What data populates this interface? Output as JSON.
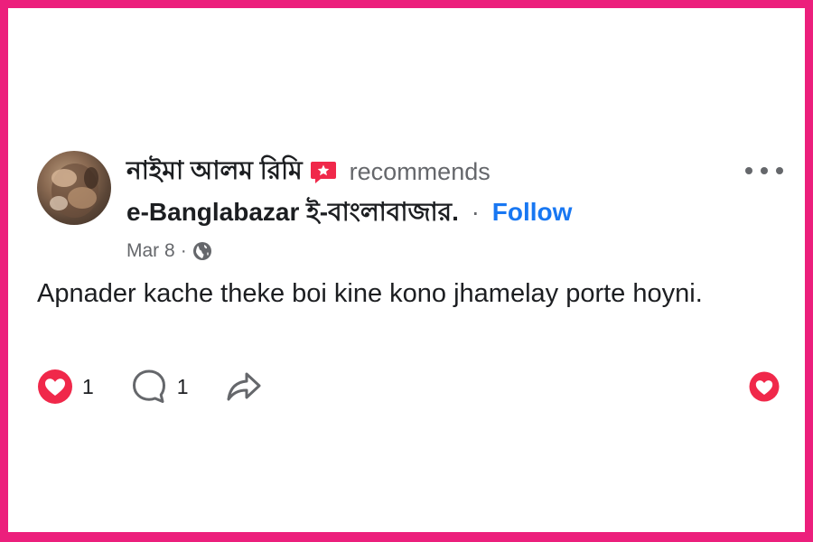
{
  "post": {
    "author_name": "নাইমা আলম রিমি",
    "recommends_text": "recommends",
    "page_name": "e-Banglabazar ই-বাংলাবাজার.",
    "separator": "·",
    "follow_label": "Follow",
    "date": "Mar 8",
    "meta_separator": "·",
    "body": "Apnader kache theke boi kine kono jhamelay porte hoyni."
  },
  "actions": {
    "like_count": "1",
    "comment_count": "1"
  },
  "colors": {
    "border": "#ec1f7c",
    "follow": "#1877f2",
    "like": "#f0284a",
    "muted": "#65676b",
    "text": "#1c1e21"
  },
  "icons": {
    "recommend": "recommend-badge-icon",
    "visibility": "globe-icon",
    "more": "more-options-icon",
    "like": "heart-icon",
    "comment": "comment-icon",
    "share": "share-icon"
  }
}
